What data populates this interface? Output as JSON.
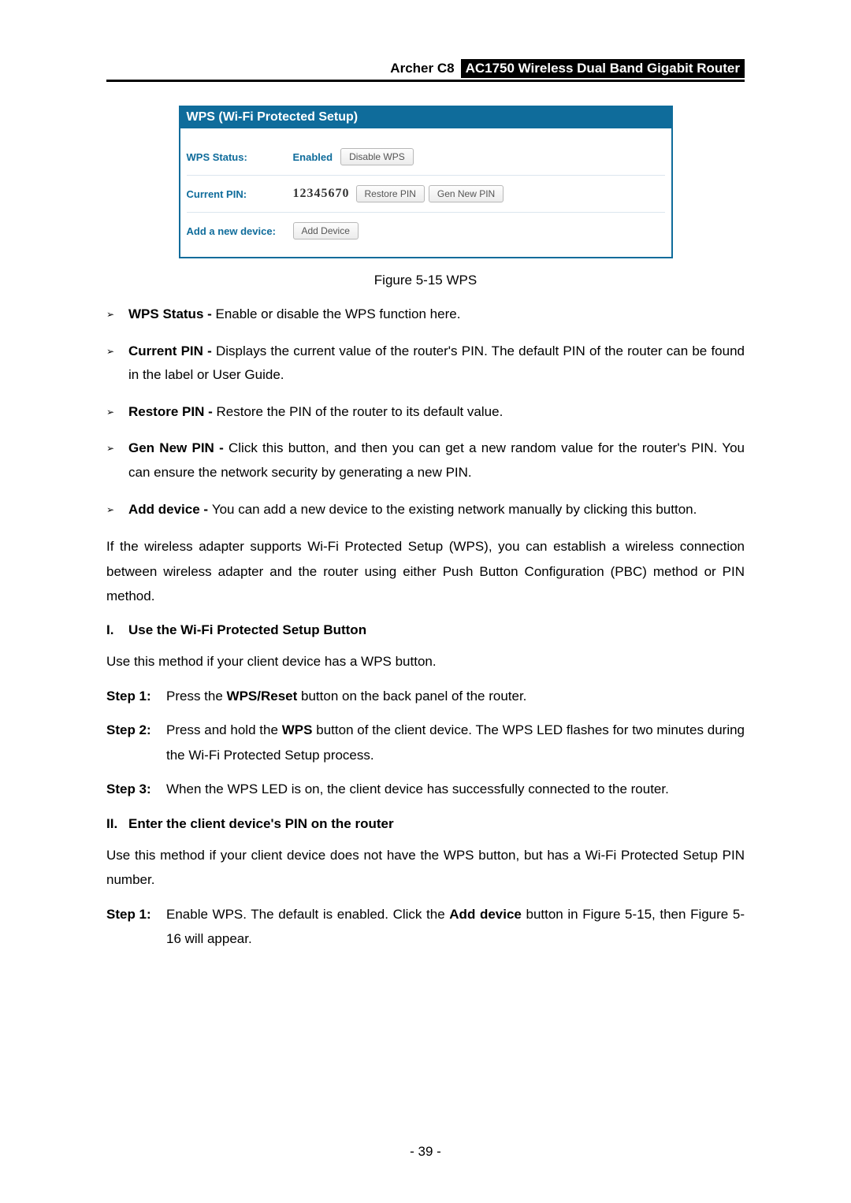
{
  "header": {
    "model": "Archer C8",
    "description": "AC1750 Wireless Dual Band Gigabit Router"
  },
  "wps_panel": {
    "title": "WPS (Wi-Fi Protected Setup)",
    "status_label": "WPS Status:",
    "status_value": "Enabled",
    "disable_btn": "Disable WPS",
    "pin_label": "Current PIN:",
    "pin_value": "12345670",
    "restore_btn": "Restore PIN",
    "gen_btn": "Gen New PIN",
    "add_label": "Add a new device:",
    "add_btn": "Add Device"
  },
  "figure_caption": "Figure 5-15 WPS",
  "bullets": {
    "b1_term": "WPS Status - ",
    "b1_text": "Enable or disable the WPS function here.",
    "b2_term": "Current PIN - ",
    "b2_text": "Displays the current value of the router's PIN. The default PIN of the router can be found in the label or User Guide.",
    "b3_term": "Restore PIN - ",
    "b3_text": "Restore the PIN of the router to its default value.",
    "b4_term": "Gen New PIN - ",
    "b4_text": "Click this button, and then you can get a new random value for the router's PIN. You can ensure the network security by generating a new PIN.",
    "b5_term": "Add device - ",
    "b5_text": "You can add a new device to the existing network manually by clicking this button."
  },
  "para1": "If the wireless adapter supports Wi-Fi Protected Setup (WPS), you can establish a wireless connection between wireless adapter and the router using either Push Button Configuration (PBC) method or PIN method.",
  "section1": {
    "num": "I.",
    "title": "Use the Wi-Fi Protected Setup Button",
    "intro": "Use this method if your client device has a WPS button.",
    "step1_label": "Step 1:",
    "step1_a": "Press the ",
    "step1_bold": "WPS/Reset",
    "step1_b": " button on the back panel of the router.",
    "step2_label": "Step 2:",
    "step2_a": "Press and hold the ",
    "step2_bold": "WPS",
    "step2_b": " button of the client device. The WPS LED flashes for two minutes during the Wi-Fi Protected Setup process.",
    "step3_label": "Step 3:",
    "step3_text": "When the WPS LED is on, the client device has successfully connected to the router."
  },
  "section2": {
    "num": "II.",
    "title": "Enter the client device's PIN on the router",
    "intro": "Use this method if your client device does not have the WPS button, but has a Wi-Fi Protected Setup PIN number.",
    "step1_label": "Step 1:",
    "step1_a": "Enable WPS. The default is enabled. Click the ",
    "step1_bold": "Add device",
    "step1_b": " button in Figure 5-15, then Figure 5-16 will appear."
  },
  "page_number": "- 39 -"
}
